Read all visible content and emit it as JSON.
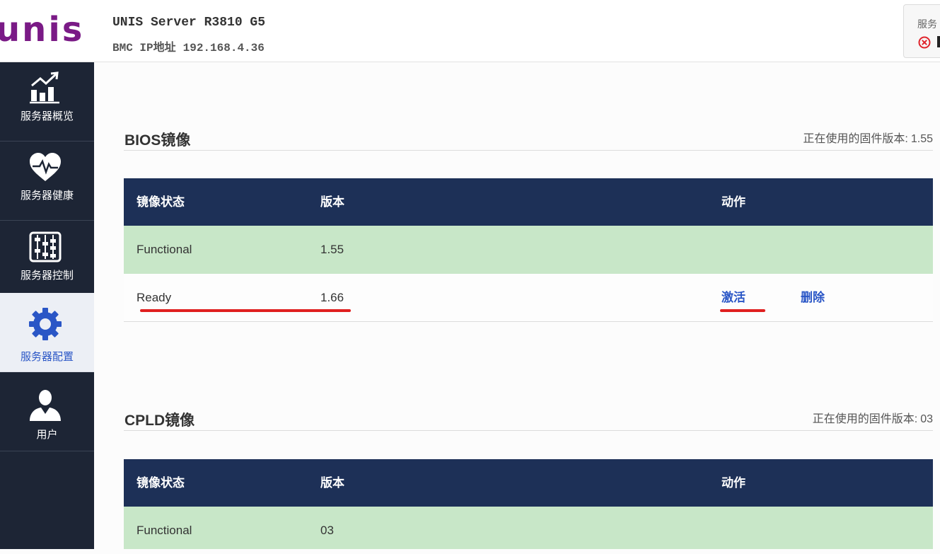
{
  "header": {
    "logo_text": "unis",
    "server_name": "UNIS Server R3810 G5",
    "bmc_ip_label": "BMC IP地址",
    "bmc_ip": "192.168.4.36",
    "status_label": "服务",
    "status_icon": "error-circle-icon"
  },
  "sidebar": {
    "items": [
      {
        "label": "服务器概览",
        "icon": "chart-icon",
        "active": false
      },
      {
        "label": "服务器健康",
        "icon": "heart-icon",
        "active": false
      },
      {
        "label": "服务器控制",
        "icon": "abacus-icon",
        "active": false
      },
      {
        "label": "服务器配置",
        "icon": "gear-icon",
        "active": true
      },
      {
        "label": "用户",
        "icon": "user-icon",
        "active": false
      }
    ]
  },
  "bios": {
    "title": "BIOS镜像",
    "fw_label": "正在使用的固件版本:",
    "fw_version": "1.55",
    "columns": [
      "镜像状态",
      "版本",
      "动作"
    ],
    "rows": [
      {
        "status": "Functional",
        "version": "1.55"
      },
      {
        "status": "Ready",
        "version": "1.66",
        "activate": "激活",
        "delete": "删除"
      }
    ]
  },
  "cpld": {
    "title": "CPLD镜像",
    "fw_label": "正在使用的固件版本:",
    "fw_version": "03",
    "columns": [
      "镜像状态",
      "版本",
      "动作"
    ],
    "rows": [
      {
        "status": "Functional",
        "version": "03"
      }
    ]
  },
  "colors": {
    "brand": "#7a1a86",
    "sidebar_bg": "#1d2535",
    "table_header": "#1d3057",
    "functional_row": "#c8e7c8",
    "link": "#2a56c6",
    "annotation": "#e02020"
  }
}
